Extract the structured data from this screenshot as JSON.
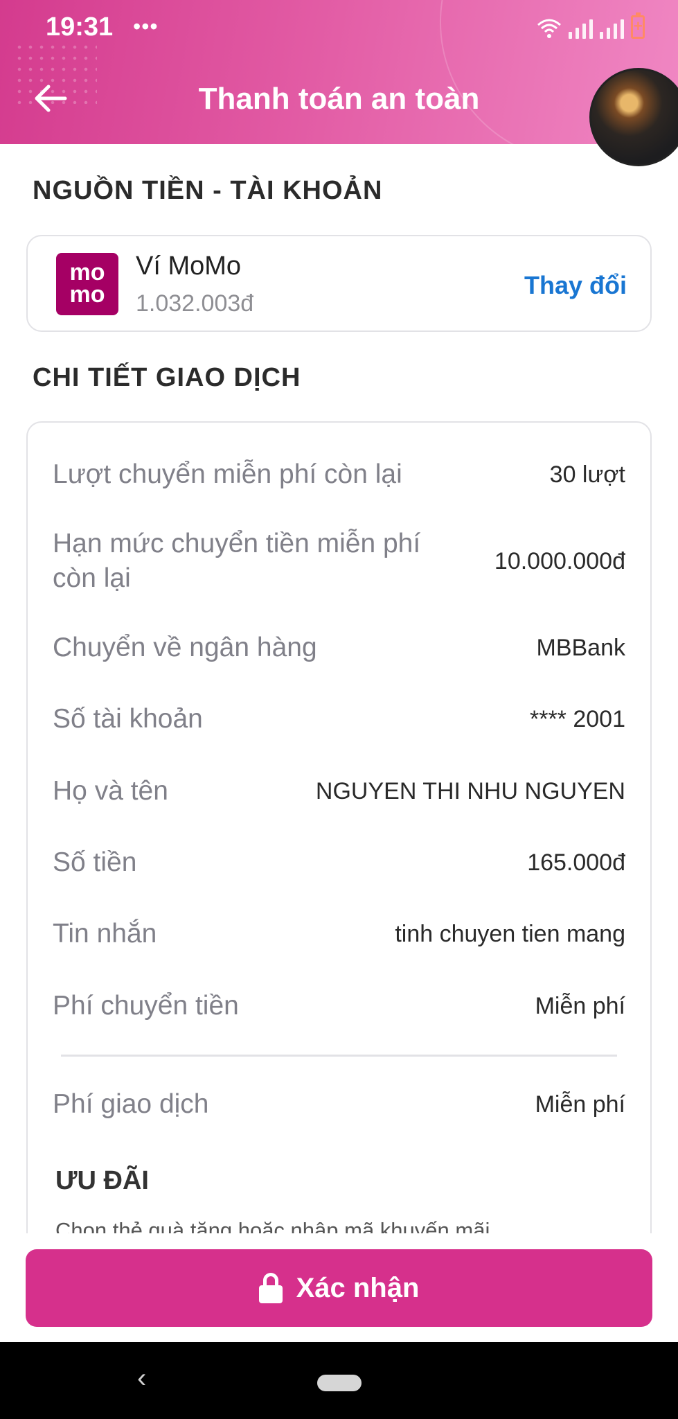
{
  "status_bar": {
    "time": "19:31",
    "dots": "•••"
  },
  "header": {
    "title": "Thanh toán an toàn"
  },
  "source": {
    "section_title": "NGUỒN TIỀN - TÀI KHOẢN",
    "logo_top": "mo",
    "logo_bottom": "mo",
    "wallet_name": "Ví MoMo",
    "balance": "1.032.003đ",
    "change_label": "Thay đổi"
  },
  "details": {
    "section_title": "CHI TIẾT GIAO DỊCH",
    "rows": [
      {
        "label": "Lượt chuyển miễn phí còn lại",
        "value": "30 lượt"
      },
      {
        "label": "Hạn mức chuyển tiền miễn phí còn lại",
        "value": "10.000.000đ"
      },
      {
        "label": "Chuyển về ngân hàng",
        "value": "MBBank"
      },
      {
        "label": "Số tài khoản",
        "value": "**** 2001"
      },
      {
        "label": "Họ và tên",
        "value": "NGUYEN THI NHU NGUYEN"
      },
      {
        "label": "Số tiền",
        "value": "165.000đ"
      },
      {
        "label": "Tin nhắn",
        "value": "tinh chuyen tien mang"
      },
      {
        "label": "Phí chuyển tiền",
        "value": "Miễn phí"
      },
      {
        "label": "Phí giao dịch",
        "value": "Miễn phí"
      }
    ],
    "promo_title": "ƯU ĐÃI",
    "promo_subtitle": "Chọn thẻ quà tặng hoặc nhập mã khuyến mãi"
  },
  "confirm": {
    "label": "Xác nhận"
  },
  "navbar": {
    "back_glyph": "‹"
  },
  "colors": {
    "brand": "#d6308c",
    "link": "#1976d2",
    "momo": "#a50064"
  }
}
